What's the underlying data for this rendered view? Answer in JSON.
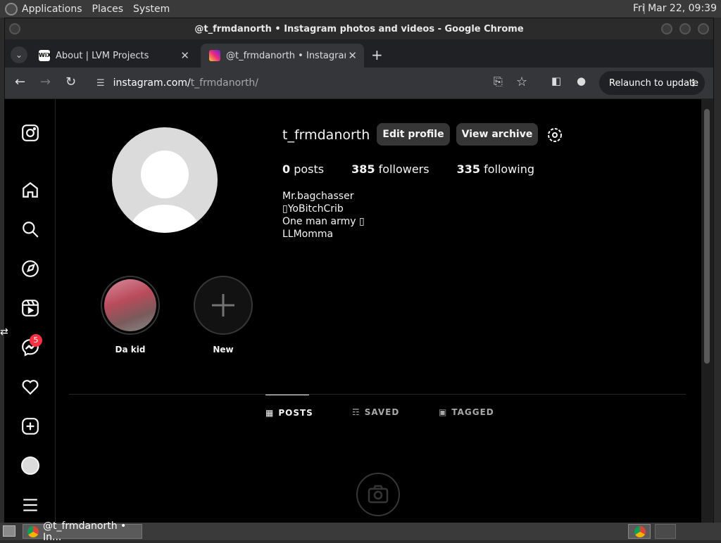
{
  "panel": {
    "menus": [
      "Applications",
      "Places",
      "System"
    ],
    "clock": "Fri Mar 22, 09:39"
  },
  "window": {
    "title": "@t_frmdanorth • Instagram photos and videos - Google Chrome"
  },
  "tabs": [
    {
      "label": "About | LVM Projects",
      "favicon": "wix-icon",
      "active": false
    },
    {
      "label": "@t_frmdanorth • Instagram",
      "favicon": "instagram-icon",
      "active": true
    }
  ],
  "toolbar": {
    "url_host": "instagram.com/",
    "url_path": "t_frmdanorth/",
    "relaunch_label": "Relaunch to update"
  },
  "profile": {
    "username": "t_frmdanorth",
    "edit_label": "Edit profile",
    "archive_label": "View archive",
    "stats": {
      "posts_count": "0",
      "posts_label": "posts",
      "followers_count": "385",
      "followers_label": "followers",
      "following_count": "335",
      "following_label": "following"
    },
    "bio": [
      "Mr.bagchasser",
      "▯YoBitchCrib",
      "One man army ▯",
      "LLMomma"
    ]
  },
  "highlights": [
    {
      "label": "Da kid"
    },
    {
      "label": "New"
    }
  ],
  "profile_tabs": [
    {
      "label": "POSTS",
      "icon": "grid-icon",
      "active": true
    },
    {
      "label": "SAVED",
      "icon": "bookmark-icon",
      "active": false
    },
    {
      "label": "TAGGED",
      "icon": "tag-icon",
      "active": false
    }
  ],
  "sidebar": {
    "messages_badge": "5"
  },
  "taskbar": {
    "task_label": "@t_frmdanorth • In..."
  },
  "colors": {
    "background": "#000000",
    "accent_badge": "#ff3040",
    "button_bg": "#363636"
  }
}
